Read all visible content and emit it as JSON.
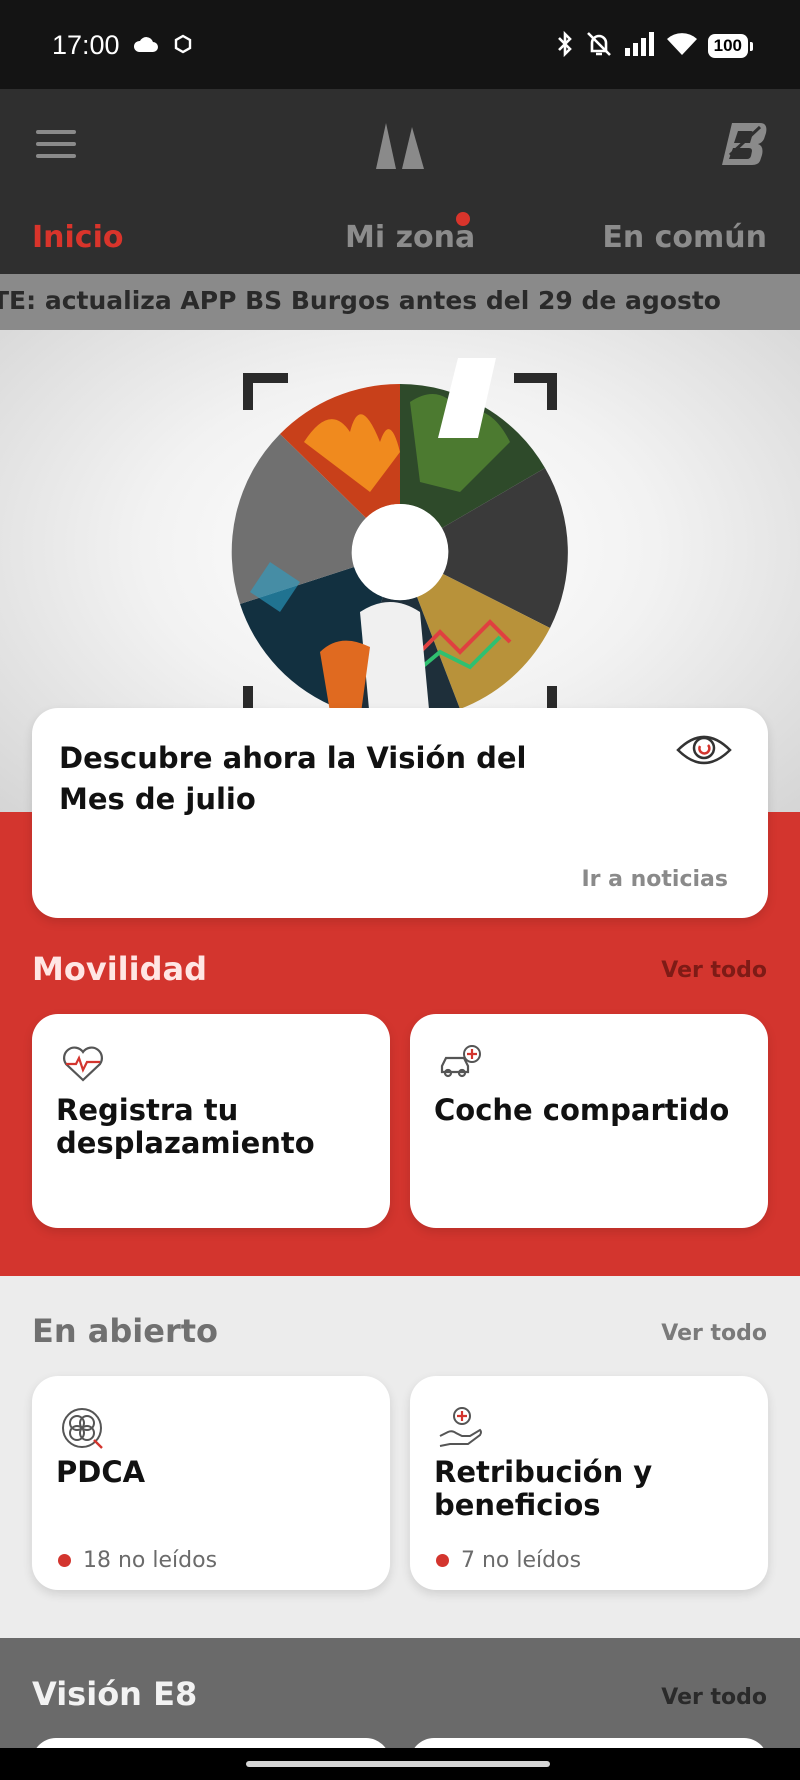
{
  "status_bar": {
    "time": "17:00",
    "battery": "100",
    "icons": [
      "cloud-icon",
      "sync-icon",
      "bluetooth-icon",
      "bell-off-icon",
      "signal-icon",
      "wifi-icon"
    ]
  },
  "header": {
    "menu_icon": "menu-icon",
    "center_logo": "bridgestone-mark-icon",
    "right_logo": "bridgestone-b-logo"
  },
  "tabs": [
    {
      "label": "Inicio",
      "active": true
    },
    {
      "label": "Mi zona",
      "active": false,
      "has_notification": true
    },
    {
      "label": "En común",
      "active": false
    }
  ],
  "ticker": {
    "text": "TE: actualiza APP BS Burgos antes del 29 de agosto"
  },
  "vision_card": {
    "title": "Descubre ahora la Visión del Mes de julio",
    "link": "Ir a noticias",
    "icon": "eye-icon"
  },
  "movilidad": {
    "title": "Movilidad",
    "see_all": "Ver todo",
    "items": [
      {
        "label": "Registra tu desplazamiento",
        "icon": "heart-pulse-icon"
      },
      {
        "label": "Coche compartido",
        "icon": "car-plus-icon"
      }
    ]
  },
  "en_abierto": {
    "title": "En abierto",
    "see_all": "Ver todo",
    "items": [
      {
        "label": "PDCA",
        "icon": "pdca-cycle-icon",
        "unread": "18 no leídos"
      },
      {
        "label": "Retribución y beneficios",
        "icon": "hand-plus-icon",
        "unread": "7 no leídos"
      }
    ]
  },
  "vision_e8": {
    "title": "Visión E8",
    "see_all": "Ver todo"
  },
  "colors": {
    "accent_red": "#d3352e",
    "header_dark": "#2f2f2f",
    "ticker_grey": "#8a8a8a"
  }
}
